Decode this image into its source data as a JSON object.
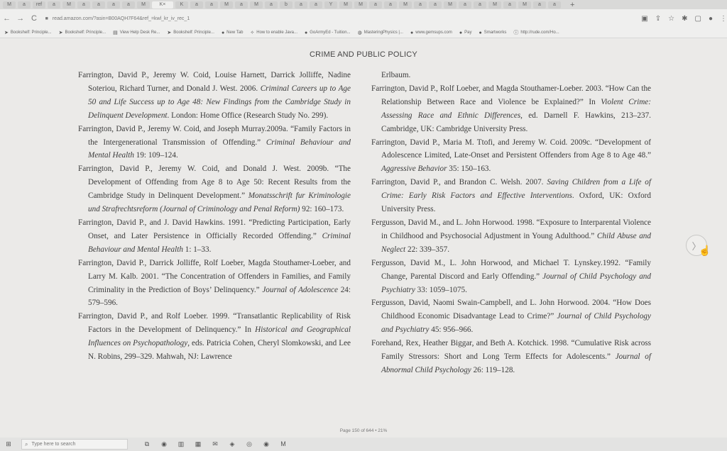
{
  "browser": {
    "tab_count": 36,
    "tab_labels": [
      "M",
      "a",
      "ref",
      "a",
      "M",
      "a",
      "a",
      "a",
      "a",
      "M",
      "K",
      "a",
      "a",
      "M",
      "a",
      "M",
      "a",
      "b",
      "a",
      "a",
      "Y",
      "M",
      "M",
      "a",
      "a",
      "M",
      "a",
      "a",
      "M",
      "a",
      "a",
      "M",
      "a",
      "M",
      "a",
      "a"
    ],
    "active_tab_label": "K×",
    "new_tab_glyph": "+",
    "url": "read.amazon.com/?asin=B00AQH7F64&ref_=kwl_kr_iv_rec_1",
    "back_glyph": "←",
    "forward_glyph": "→",
    "reload_glyph": "C"
  },
  "bookmarks": [
    {
      "label": "Bookshelf: Principle...",
      "icon": "bookshelf-icon"
    },
    {
      "label": "Bookshelf: Principle...",
      "icon": "bookshelf-icon"
    },
    {
      "label": "View Help Desk Re...",
      "icon": "helpdesk-icon"
    },
    {
      "label": "Bookshelf: Principle...",
      "icon": "bookshelf-icon"
    },
    {
      "label": "New Tab",
      "icon": "globe-icon"
    },
    {
      "label": "How to enable Java...",
      "icon": "java-icon"
    },
    {
      "label": "GoArmyEd - Tuition...",
      "icon": "globe-icon"
    },
    {
      "label": "MasteringPhysics |...",
      "icon": "physics-icon"
    },
    {
      "label": "www.gemsups.com",
      "icon": "globe-icon"
    },
    {
      "label": "Pay",
      "icon": "globe-icon"
    },
    {
      "label": "Smartworks",
      "icon": "globe-icon"
    },
    {
      "label": "http://rude.com/Ho...",
      "icon": "info-icon"
    }
  ],
  "document": {
    "running_head": "CRIME AND PUBLIC POLICY",
    "status": "Page 150 of 644 • 21%",
    "left_refs": [
      {
        "pre": "Farrington, David P., Jeremy W. Coid, Louise Harnett, Darrick Jolliffe, Nadine Soteriou, Richard Turner, and Donald J. West. 2006. ",
        "ital": "Criminal Careers up to Age 50 and Life Success up to Age 48: New Findings from the Cambridge Study in Delinquent Development",
        "post": ". London: Home Office (Research Study No. 299)."
      },
      {
        "pre": "Farrington, David P., Jeremy W. Coid, and Joseph Murray.2009a. “Family Factors in the Intergenerational Transmission of Offending.” ",
        "ital": "Criminal Behaviour and Mental Health",
        "post": " 19: 109–124."
      },
      {
        "pre": "Farrington, David P., Jeremy W. Coid, and Donald J. West. 2009b. “The Development of Offending from Age 8 to Age 50: Recent Results from the Cambridge Study in Delinquent Development.” ",
        "ital": "Monatsschrift fur Kriminologie und Strafrechtsreform (Journal of Criminology and Penal Reform)",
        "post": " 92: 160–173."
      },
      {
        "pre": "Farrington, David P., and J. David Hawkins. 1991. “Predicting Participation, Early Onset, and Later Persistence in Officially Recorded Offending.” ",
        "ital": "Criminal Behaviour and Mental Health",
        "post": " 1: 1–33."
      },
      {
        "pre": "Farrington, David P., Darrick Jolliffe, Rolf Loeber, Magda Stouthamer-Loeber, and Larry M. Kalb. 2001. “The Concentration of Offenders in Families, and Family Criminality in the Prediction of Boys’ Delinquency.” ",
        "ital": "Journal of Adolescence",
        "post": " 24: 579–596."
      },
      {
        "pre": "Farrington, David P., and Rolf Loeber. 1999. “Transatlantic Replicability of Risk Factors in the Development of Delinquency.” In ",
        "ital": "Historical and Geographical Influences on Psychopathology",
        "post": ", eds. Patricia Cohen, Cheryl Slomkowski, and Lee N. Robins, 299–329. Mahwah, NJ: Lawrence"
      }
    ],
    "right_cont": "Erlbaum.",
    "right_refs": [
      {
        "pre": "Farrington, David P., Rolf Loeber, and Magda Stouthamer-Loeber. 2003. “How Can the Relationship Between Race and Violence be Explained?” In ",
        "ital": "Violent Crime: Assessing Race and Ethnic Differences",
        "post": ", ed. Darnell F. Hawkins, 213–237. Cambridge, UK: Cambridge University Press."
      },
      {
        "pre": "Farrington, David P., Maria M. Ttofi, and Jeremy W. Coid. 2009c. “Development of Adolescence Limited, Late-Onset and Persistent Offenders from Age 8 to Age 48.” ",
        "ital": "Aggressive Behavior",
        "post": " 35: 150–163."
      },
      {
        "pre": "Farrington, David P., and Brandon C. Welsh. 2007. ",
        "ital": "Saving Children from a Life of Crime: Early Risk Factors and Effective Interventions",
        "post": ". Oxford, UK: Oxford University Press."
      },
      {
        "pre": "Fergusson, David M., and L. John Horwood. 1998. “Exposure to Interparental Violence in Childhood and Psychosocial Adjustment in Young Adulthood.” ",
        "ital": "Child Abuse and Neglect",
        "post": " 22: 339–357."
      },
      {
        "pre": "Fergusson, David M., L. John Horwood, and Michael T. Lynskey.1992. “Family Change, Parental Discord and Early Offending.” ",
        "ital": "Journal of Child Psychology and Psychiatry",
        "post": " 33: 1059–1075."
      },
      {
        "pre": "Fergusson, David, Naomi Swain-Campbell, and L. John Horwood. 2004. “How Does Childhood Economic Disadvantage Lead to Crime?” ",
        "ital": "Journal of Child Psychology and Psychiatry",
        "post": " 45: 956–966."
      },
      {
        "pre": "Forehand, Rex, Heather Biggar, and Beth A. Kotchick. 1998. “Cumulative Risk across Family Stressors: Short and Long Term Effects for Adolescents.” ",
        "ital": "Journal of Abnormal Child Psychology",
        "post": " 26: 119–128."
      }
    ],
    "next_glyph": "〉"
  },
  "taskbar": {
    "search_placeholder": "Type here to search",
    "apps": [
      "task-view-icon",
      "edge-icon",
      "file-explorer-icon",
      "store-icon",
      "mail-icon",
      "photos-icon",
      "chrome-icon",
      "edge-icon",
      "gmail-icon"
    ]
  }
}
